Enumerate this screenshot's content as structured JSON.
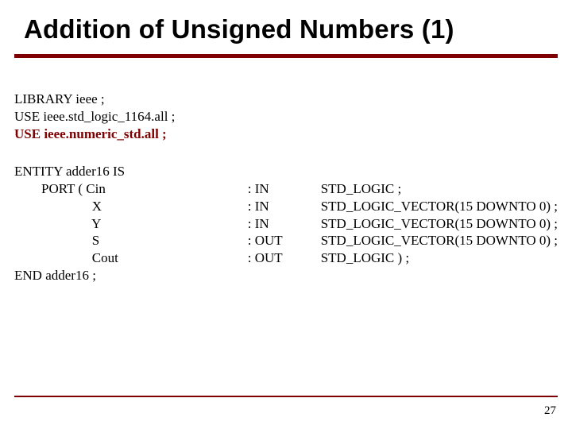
{
  "title": "Addition of Unsigned Numbers (1)",
  "libs": {
    "l1": "LIBRARY ieee ;",
    "l2": "USE ieee.std_logic_1164.all ;",
    "l3": "USE ieee.numeric_std.all ;"
  },
  "entity": {
    "col1": "ENTITY adder16 IS\n        PORT ( Cin\n                       X\n                       Y\n                       S\n                       Cout\nEND adder16 ;",
    "col2": "\n: IN\n: IN\n: IN\n: OUT\n: OUT",
    "col3": "\nSTD_LOGIC ;\nSTD_LOGIC_VECTOR(15 DOWNTO 0) ;\nSTD_LOGIC_VECTOR(15 DOWNTO 0) ;\nSTD_LOGIC_VECTOR(15 DOWNTO 0) ;\nSTD_LOGIC ) ;"
  },
  "page_number": "27"
}
